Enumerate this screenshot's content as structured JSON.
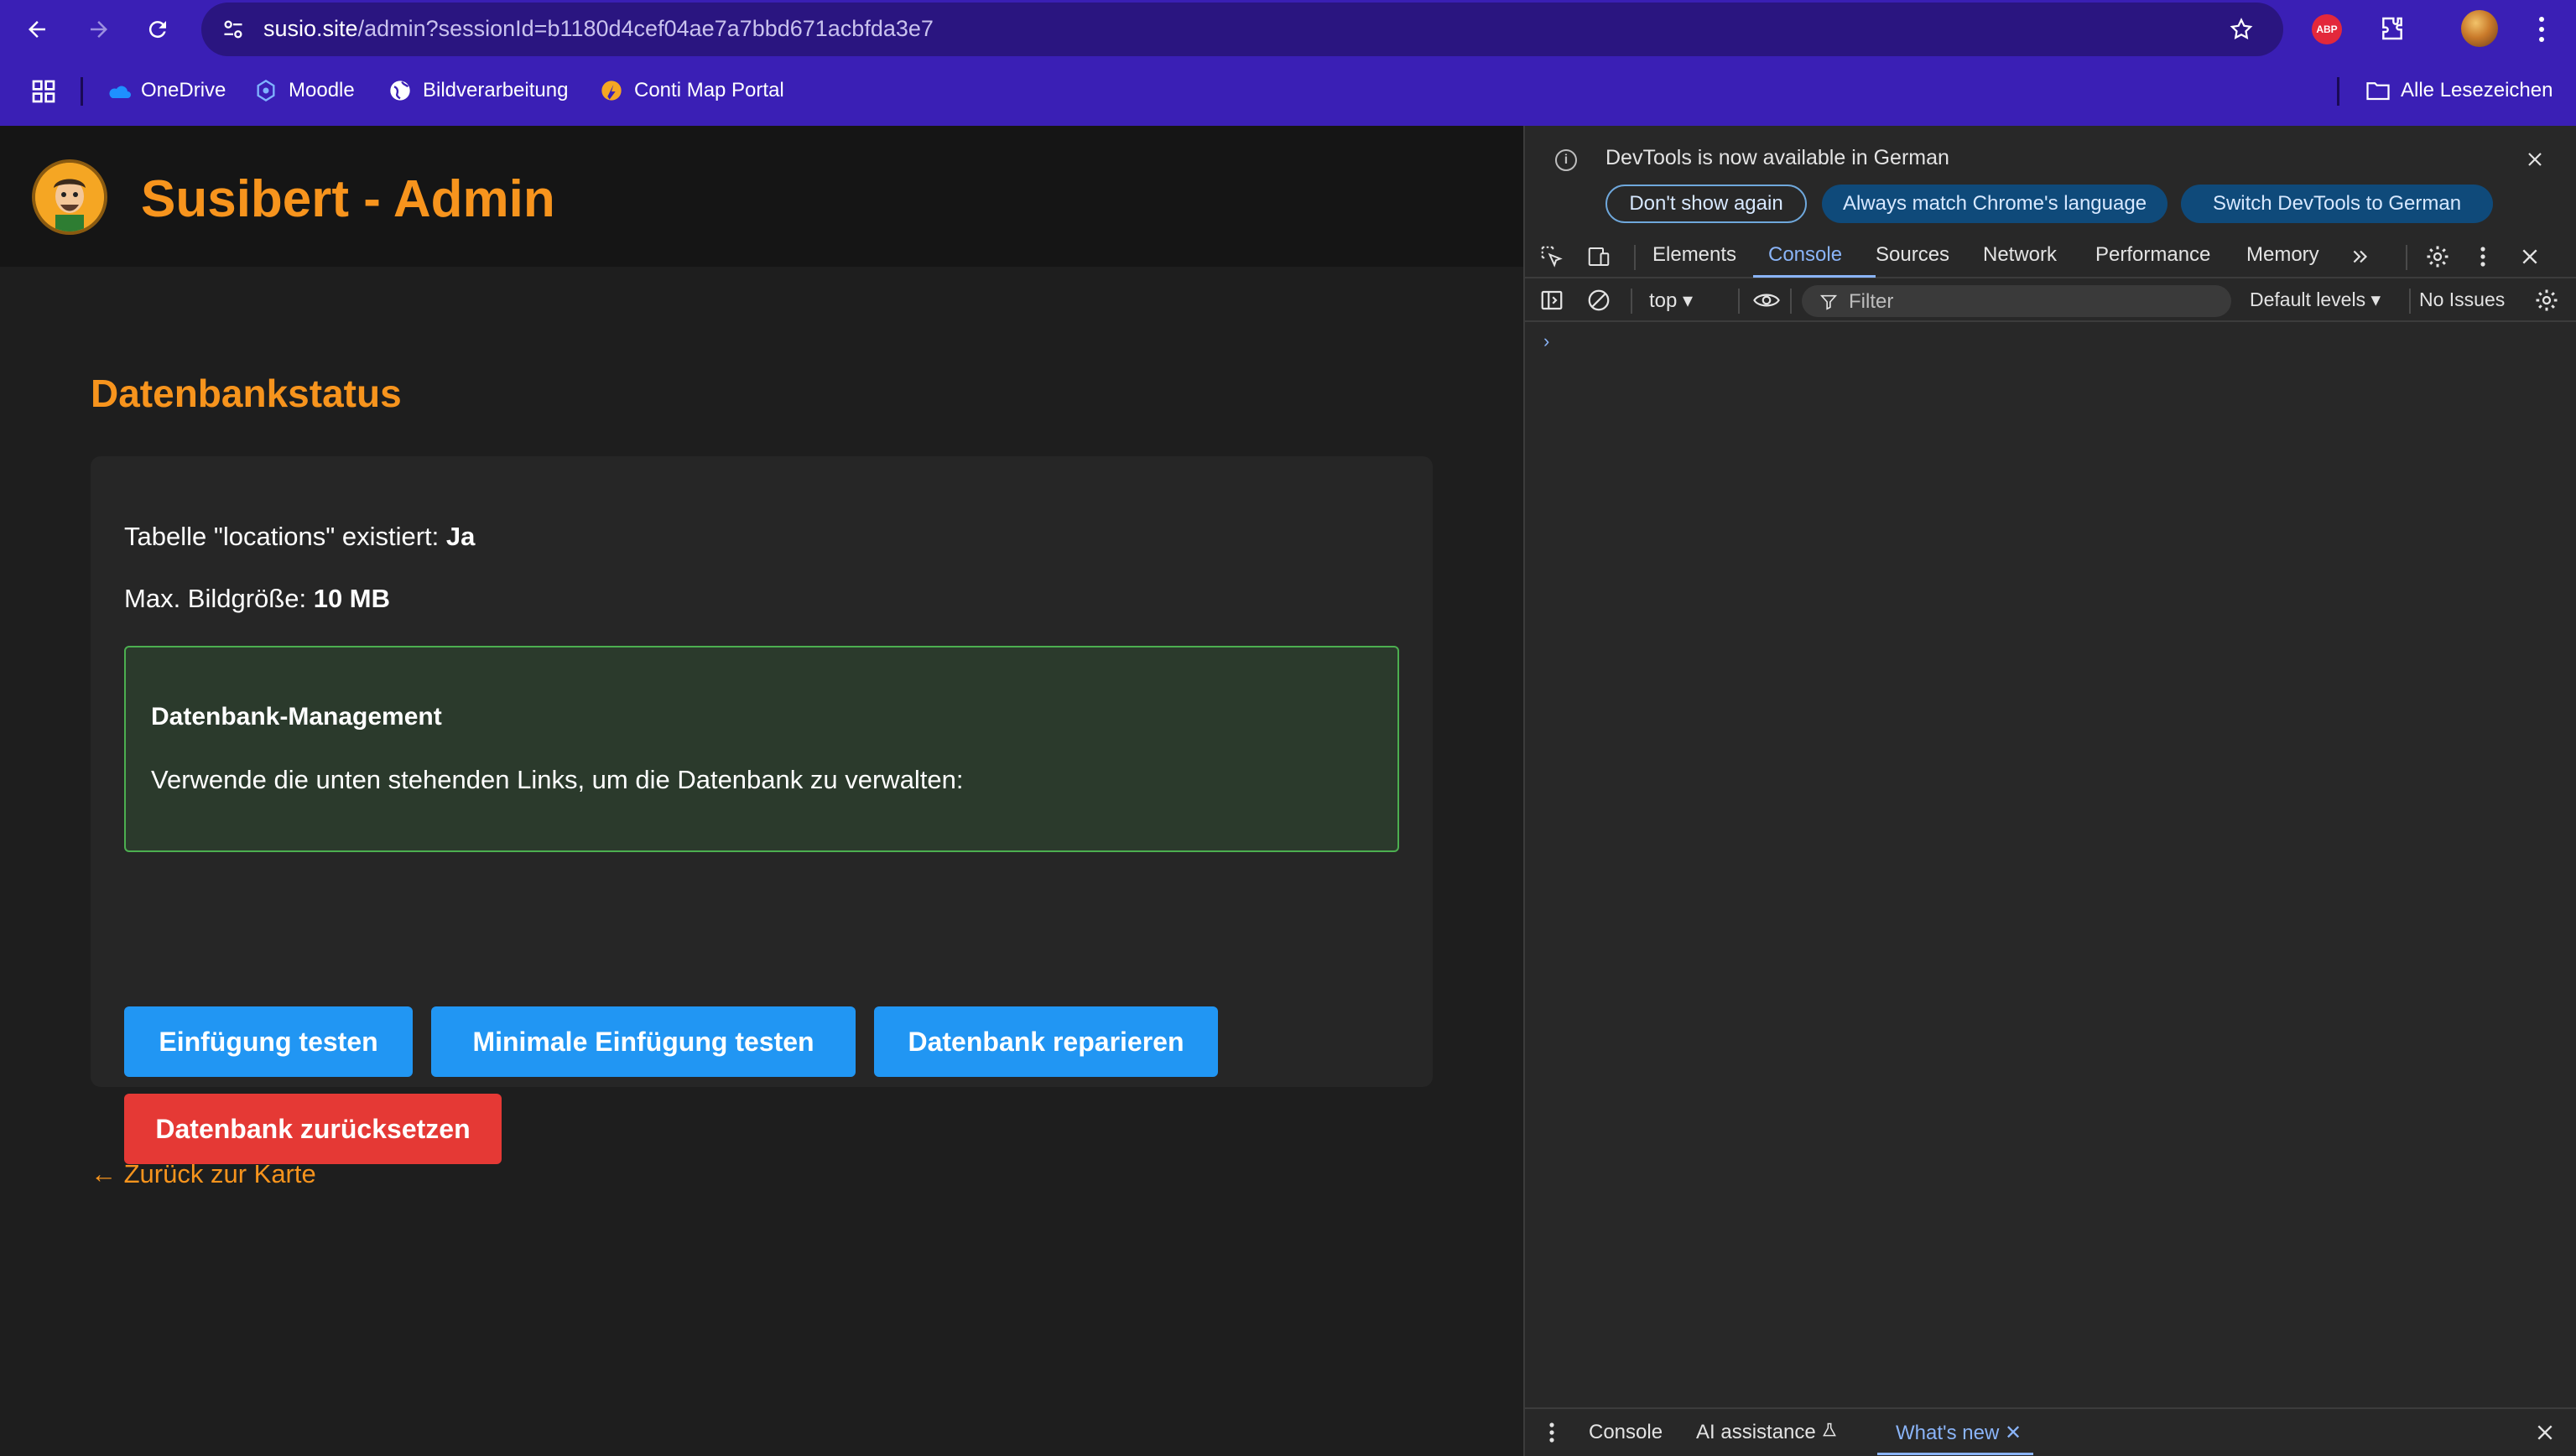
{
  "browser": {
    "url_host": "susio.site",
    "url_path": "/admin?sessionId=b1180d4cef04ae7a7bbd671acbfda3e7",
    "extension_badge": "ABP",
    "bookmarks": [
      {
        "label": "OneDrive",
        "icon": "onedrive-icon"
      },
      {
        "label": "Moodle",
        "icon": "moodle-icon"
      },
      {
        "label": "Bildverarbeitung",
        "icon": "globe-icon"
      },
      {
        "label": "Conti Map Portal",
        "icon": "conti-icon"
      }
    ],
    "all_bookmarks_label": "Alle Lesezeichen"
  },
  "site": {
    "title": "Susibert - Admin",
    "section_title": "Datenbankstatus",
    "stats": {
      "table_label": "Tabelle \"locations\" existiert: ",
      "table_value": "Ja",
      "size_label": "Max. Bildgröße: ",
      "size_value": "10 MB"
    },
    "info_box": {
      "title": "Datenbank-Management",
      "text": "Verwende die unten stehenden Links, um die Datenbank zu verwalten:"
    },
    "buttons": {
      "test_insert": "Einfügung testen",
      "min_insert": "Minimale Einfügung testen",
      "repair": "Datenbank reparieren",
      "reset": "Datenbank zurücksetzen"
    },
    "back_link": "← Zurück zur Karte",
    "colors": {
      "accent": "#f7941d",
      "primary_button": "#2196f3",
      "danger_button": "#e53935",
      "info_border": "#4caf50"
    }
  },
  "devtools": {
    "infobar": {
      "message": "DevTools is now available in German",
      "dont_show": "Don't show again",
      "match_language": "Always match Chrome's language",
      "switch_german": "Switch DevTools to German"
    },
    "tabs": [
      "Elements",
      "Console",
      "Sources",
      "Network",
      "Performance",
      "Memory"
    ],
    "active_tab": "Console",
    "console": {
      "context": "top",
      "filter_placeholder": "Filter",
      "levels": "Default levels",
      "issues": "No Issues",
      "prompt": "›"
    },
    "drawer": {
      "console": "Console",
      "ai": "AI assistance",
      "whats_new": "What's new"
    }
  }
}
